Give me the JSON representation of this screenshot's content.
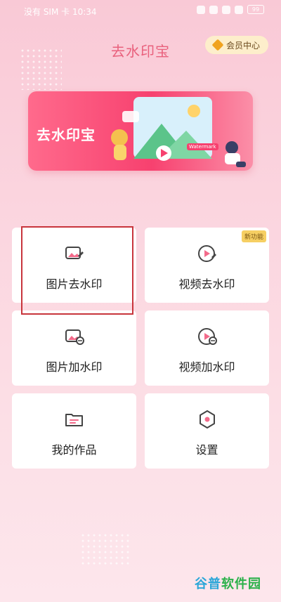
{
  "status_bar": {
    "left_text": "没有 SIM 卡 10:34",
    "battery": "99"
  },
  "header": {
    "title": "去水印宝",
    "member_button": "会员中心"
  },
  "banner": {
    "title": "去水印宝",
    "tag": "Watermark"
  },
  "features": [
    {
      "label": "图片去水印",
      "icon": "image-erase-icon"
    },
    {
      "label": "视频去水印",
      "icon": "video-erase-icon",
      "badge": "新功能"
    },
    {
      "label": "图片加水印",
      "icon": "image-add-watermark-icon"
    },
    {
      "label": "视频加水印",
      "icon": "video-add-watermark-icon"
    },
    {
      "label": "我的作品",
      "icon": "folder-icon"
    },
    {
      "label": "设置",
      "icon": "settings-hex-icon"
    }
  ],
  "watermark": {
    "part1": "谷普",
    "part2": "软件园"
  },
  "colors": {
    "accent": "#e9617d",
    "highlight_box": "#c8353c"
  }
}
